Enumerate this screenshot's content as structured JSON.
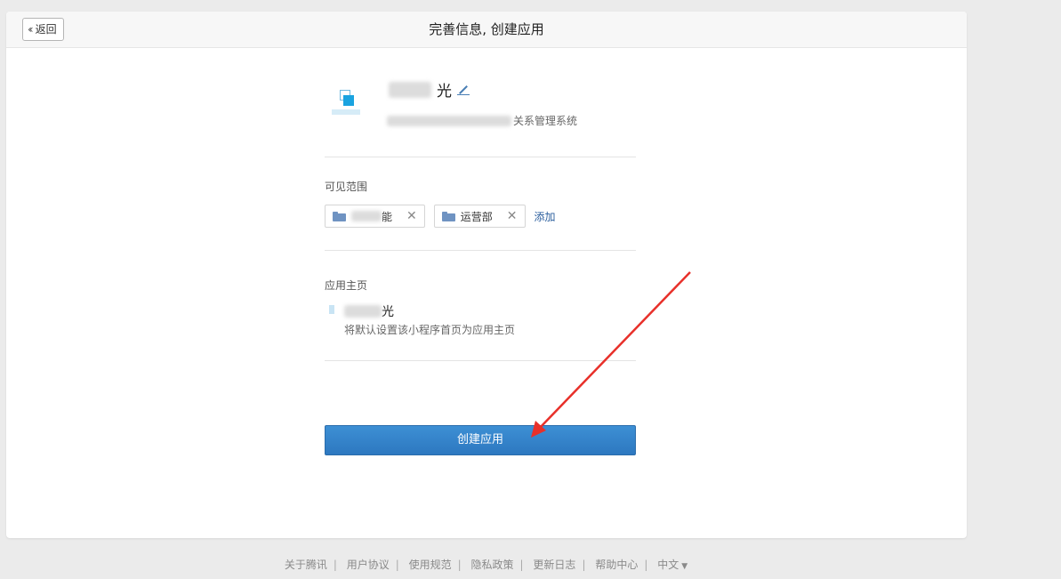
{
  "header": {
    "back_label": "返回",
    "title": "完善信息, 创建应用"
  },
  "app": {
    "name_visible": "光",
    "desc_visible": "关系管理系统",
    "logo_color": "#1aa3e0"
  },
  "scope": {
    "label": "可见范围",
    "tags": [
      {
        "label": "能"
      },
      {
        "label": "运营部"
      }
    ],
    "add_label": "添加"
  },
  "homepage": {
    "label": "应用主页",
    "mini_program_name_visible": "光",
    "hint": "将默认设置该小程序首页为应用主页"
  },
  "create_button": "创建应用",
  "footer": {
    "links": [
      "关于腾讯",
      "用户协议",
      "使用规范",
      "隐私政策",
      "更新日志",
      "帮助中心"
    ],
    "language": "中文"
  },
  "colors": {
    "accent": "#2d78c0",
    "link": "#2c5f9e",
    "annotation_arrow": "#e8302a"
  }
}
